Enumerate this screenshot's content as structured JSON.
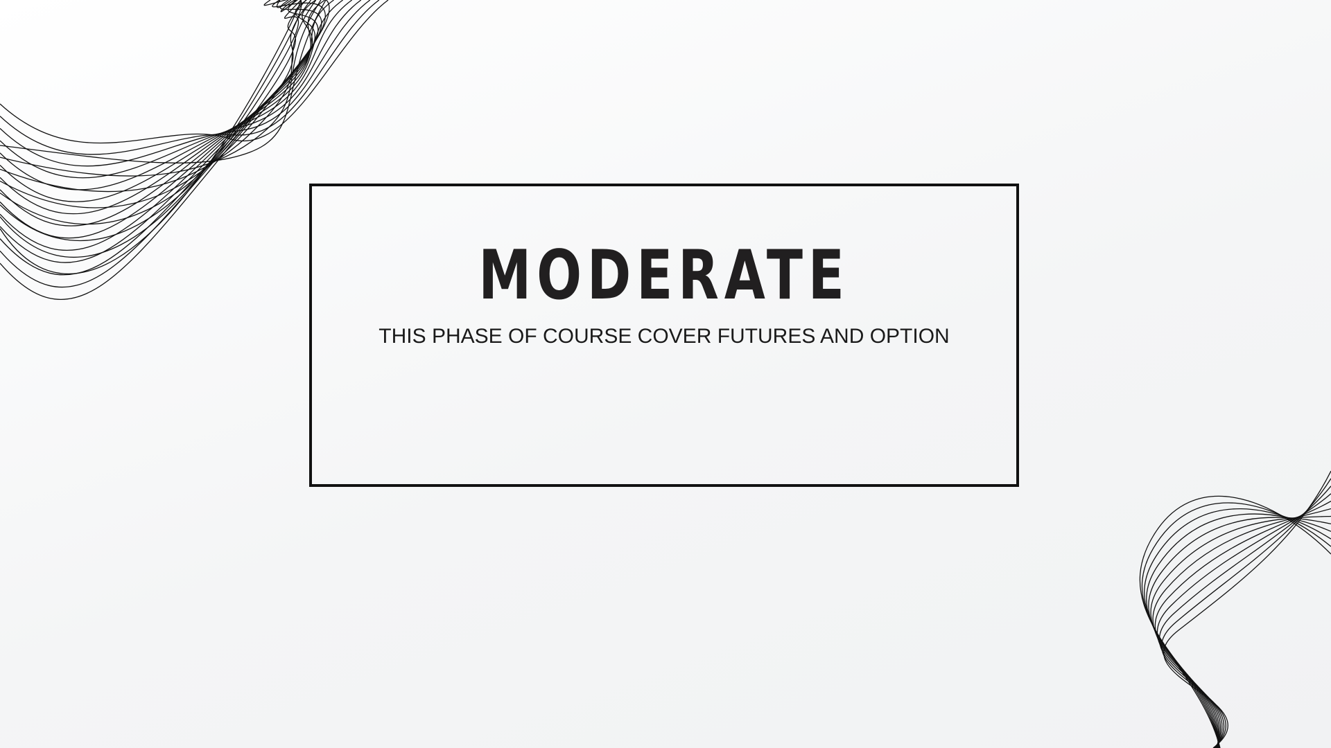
{
  "slide": {
    "title": "MODERATE",
    "subtitle": "THIS PHASE OF COURSE COVER FUTURES AND OPTION"
  },
  "decorations": {
    "top_left": "wave-lines-icon",
    "bottom_right": "wave-lines-icon"
  },
  "colors": {
    "background": "#f5f6f7",
    "ink": "#111111",
    "title": "#211f20"
  }
}
